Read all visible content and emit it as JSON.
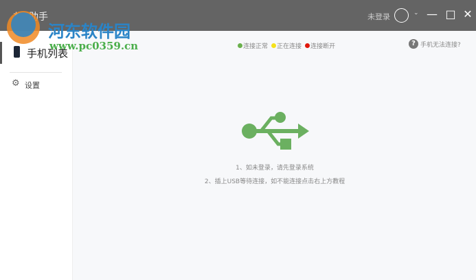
{
  "window": {
    "title": "助手",
    "login_status": "未登录"
  },
  "sidebar": {
    "items": [
      {
        "label": "手机列表"
      },
      {
        "label": "设置"
      }
    ]
  },
  "main": {
    "legend": [
      {
        "label": "连接正常",
        "color": "#6ab04c"
      },
      {
        "label": "正在连接",
        "color": "#f5e11b"
      },
      {
        "label": "连接断开",
        "color": "#e0180c"
      }
    ],
    "help_link": "手机无法连接?",
    "hints": [
      "1、如未登录，请先登录系统",
      "2、插上USB等待连接，如不能连接点击右上方教程"
    ],
    "usb_color": "#6bb060"
  },
  "watermark": {
    "name": "河东软件园",
    "url": "www.pc0359.cn"
  }
}
